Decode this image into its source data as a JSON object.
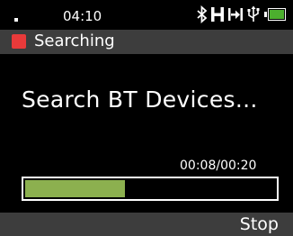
{
  "status_bar": {
    "time": "04:10",
    "icons": [
      "bluetooth-icon",
      "h-network-icon",
      "call-forward-icon",
      "usb-icon",
      "battery-icon"
    ],
    "battery_color": "#4caf2e"
  },
  "title_bar": {
    "title": "Searching",
    "indicator_color": "#e83a3a"
  },
  "main": {
    "heading": "Search BT Devices...",
    "counter": "00:08/00:20",
    "progress_fraction": 0.4,
    "progress_color": "#8cb04f"
  },
  "bottom_bar": {
    "right_softkey": "Stop"
  }
}
